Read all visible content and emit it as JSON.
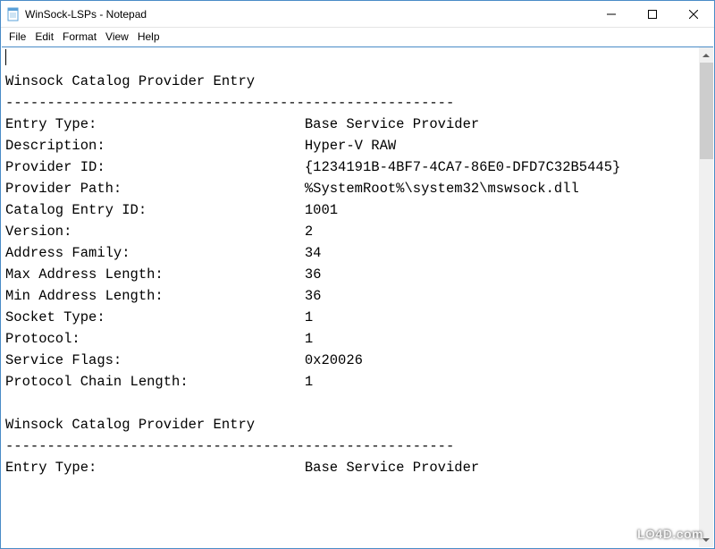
{
  "window": {
    "title": "WinSock-LSPs - Notepad"
  },
  "menu": {
    "file": "File",
    "edit": "Edit",
    "format": "Format",
    "view": "View",
    "help": "Help"
  },
  "content": {
    "text": "\nWinsock Catalog Provider Entry\n------------------------------------------------------\nEntry Type:                         Base Service Provider\nDescription:                        Hyper-V RAW\nProvider ID:                        {1234191B-4BF7-4CA7-86E0-DFD7C32B5445}\nProvider Path:                      %SystemRoot%\\system32\\mswsock.dll\nCatalog Entry ID:                   1001\nVersion:                            2\nAddress Family:                     34\nMax Address Length:                 36\nMin Address Length:                 36\nSocket Type:                        1\nProtocol:                           1\nService Flags:                      0x20026\nProtocol Chain Length:              1\n\nWinsock Catalog Provider Entry\n------------------------------------------------------\nEntry Type:                         Base Service Provider"
  },
  "watermark": "LO4D.com"
}
